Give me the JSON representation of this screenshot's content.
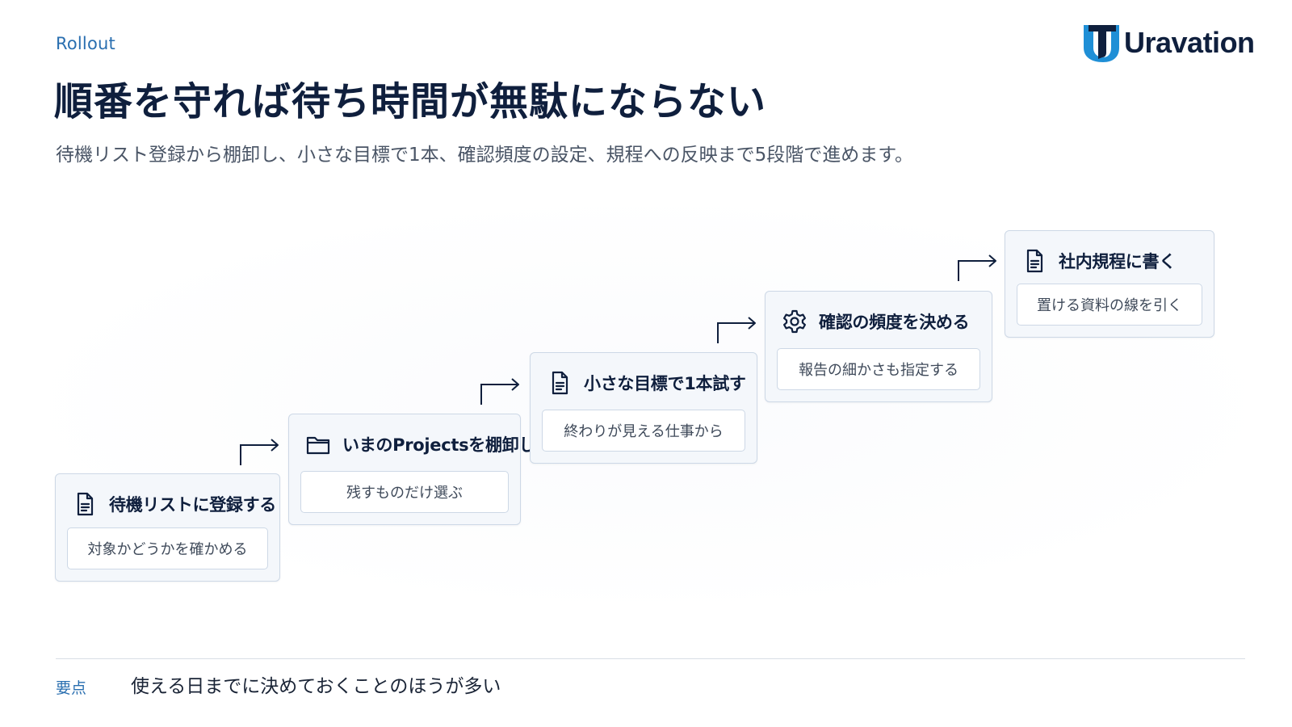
{
  "header": {
    "eyebrow": "Rollout",
    "title": "順番を守れば待ち時間が無駄にならない",
    "subtitle": "待機リスト登録から棚卸し、小さな目標で1本、確認頻度の設定、規程への反映まで5段階で進めます。",
    "logo_text": "Uravation"
  },
  "steps": [
    {
      "title": "待機リストに登録する",
      "note": "対象かどうかを確かめる",
      "icon": "document-icon"
    },
    {
      "title": "いまのProjectsを棚卸し",
      "note": "残すものだけ選ぶ",
      "icon": "folder-icon"
    },
    {
      "title": "小さな目標で1本試す",
      "note": "終わりが見える仕事から",
      "icon": "document-icon"
    },
    {
      "title": "確認の頻度を決める",
      "note": "報告の細かさも指定する",
      "icon": "gear-icon"
    },
    {
      "title": "社内規程に書く",
      "note": "置ける資料の線を引く",
      "icon": "document-icon"
    }
  ],
  "footer": {
    "label": "要点",
    "text": "使える日までに決めておくことのほうが多い"
  },
  "colors": {
    "navy": "#0f1f3d",
    "accent_blue": "#2a6fb0",
    "card_bg": "#f4f7fb",
    "card_border": "#cdd8e6"
  }
}
